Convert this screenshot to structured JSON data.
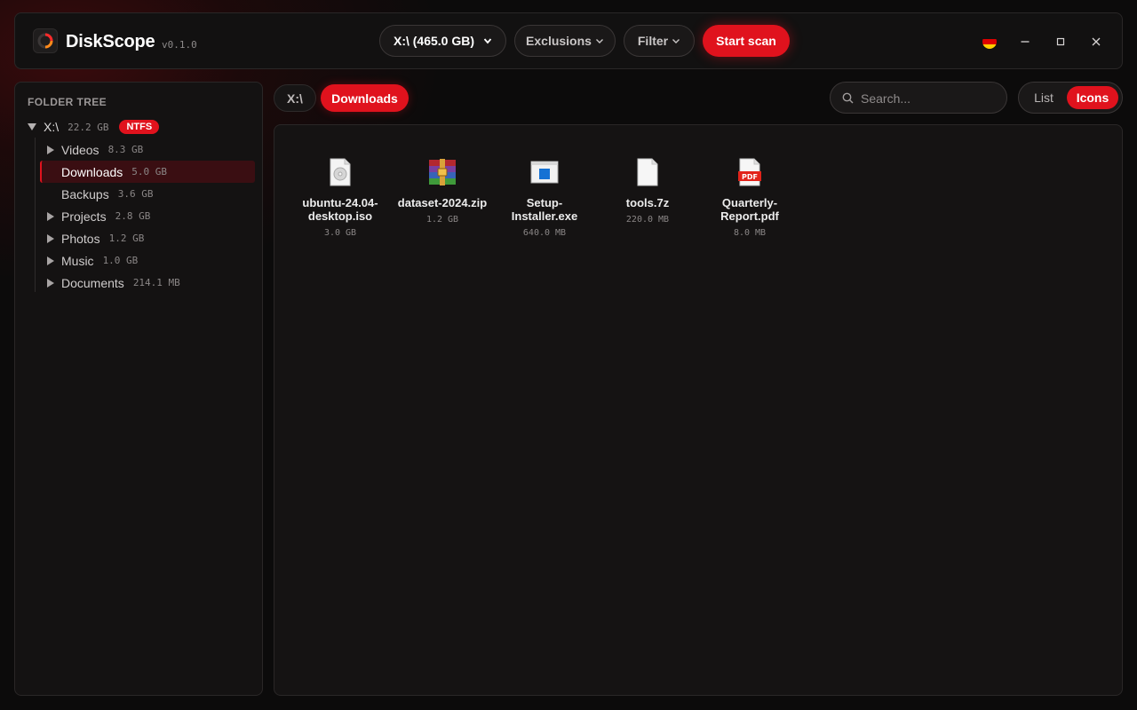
{
  "app": {
    "name": "DiskScope",
    "version": "v0.1.0"
  },
  "toolbar": {
    "drive_select_value": "X:\\ (465.0 GB)",
    "exclusions_label": "Exclusions",
    "filter_label": "Filter",
    "start_scan_label": "Start scan",
    "accent_color": "#e0121d"
  },
  "sidebar": {
    "title": "FOLDER TREE",
    "root": {
      "label": "X:\\",
      "size": "22.2 GB",
      "badge": "NTFS"
    },
    "items": [
      {
        "label": "Videos",
        "size": "8.3 GB",
        "expandable": true
      },
      {
        "label": "Downloads",
        "size": "5.0 GB",
        "expandable": false,
        "selected": true
      },
      {
        "label": "Backups",
        "size": "3.6 GB",
        "expandable": false
      },
      {
        "label": "Projects",
        "size": "2.8 GB",
        "expandable": true
      },
      {
        "label": "Photos",
        "size": "1.2 GB",
        "expandable": true
      },
      {
        "label": "Music",
        "size": "1.0 GB",
        "expandable": true
      },
      {
        "label": "Documents",
        "size": "214.1 MB",
        "expandable": true
      }
    ]
  },
  "breadcrumb": {
    "root": "X:\\",
    "current": "Downloads"
  },
  "search": {
    "placeholder": "Search..."
  },
  "view": {
    "list_label": "List",
    "icons_label": "Icons",
    "active": "Icons"
  },
  "files": [
    {
      "name_line1": "ubuntu-24.04-",
      "name_line2": "desktop.iso",
      "size": "3.0 GB",
      "icon": "disc-image-icon"
    },
    {
      "name_line1": "dataset-2024.zip",
      "name_line2": "",
      "size": "1.2 GB",
      "icon": "archive-icon"
    },
    {
      "name_line1": "Setup-",
      "name_line2": "Installer.exe",
      "size": "640.0 MB",
      "icon": "executable-icon"
    },
    {
      "name_line1": "tools.7z",
      "name_line2": "",
      "size": "220.0 MB",
      "icon": "file-icon"
    },
    {
      "name_line1": "Quarterly-",
      "name_line2": "Report.pdf",
      "size": "8.0 MB",
      "icon": "pdf-icon",
      "icon_text": "PDF"
    }
  ]
}
